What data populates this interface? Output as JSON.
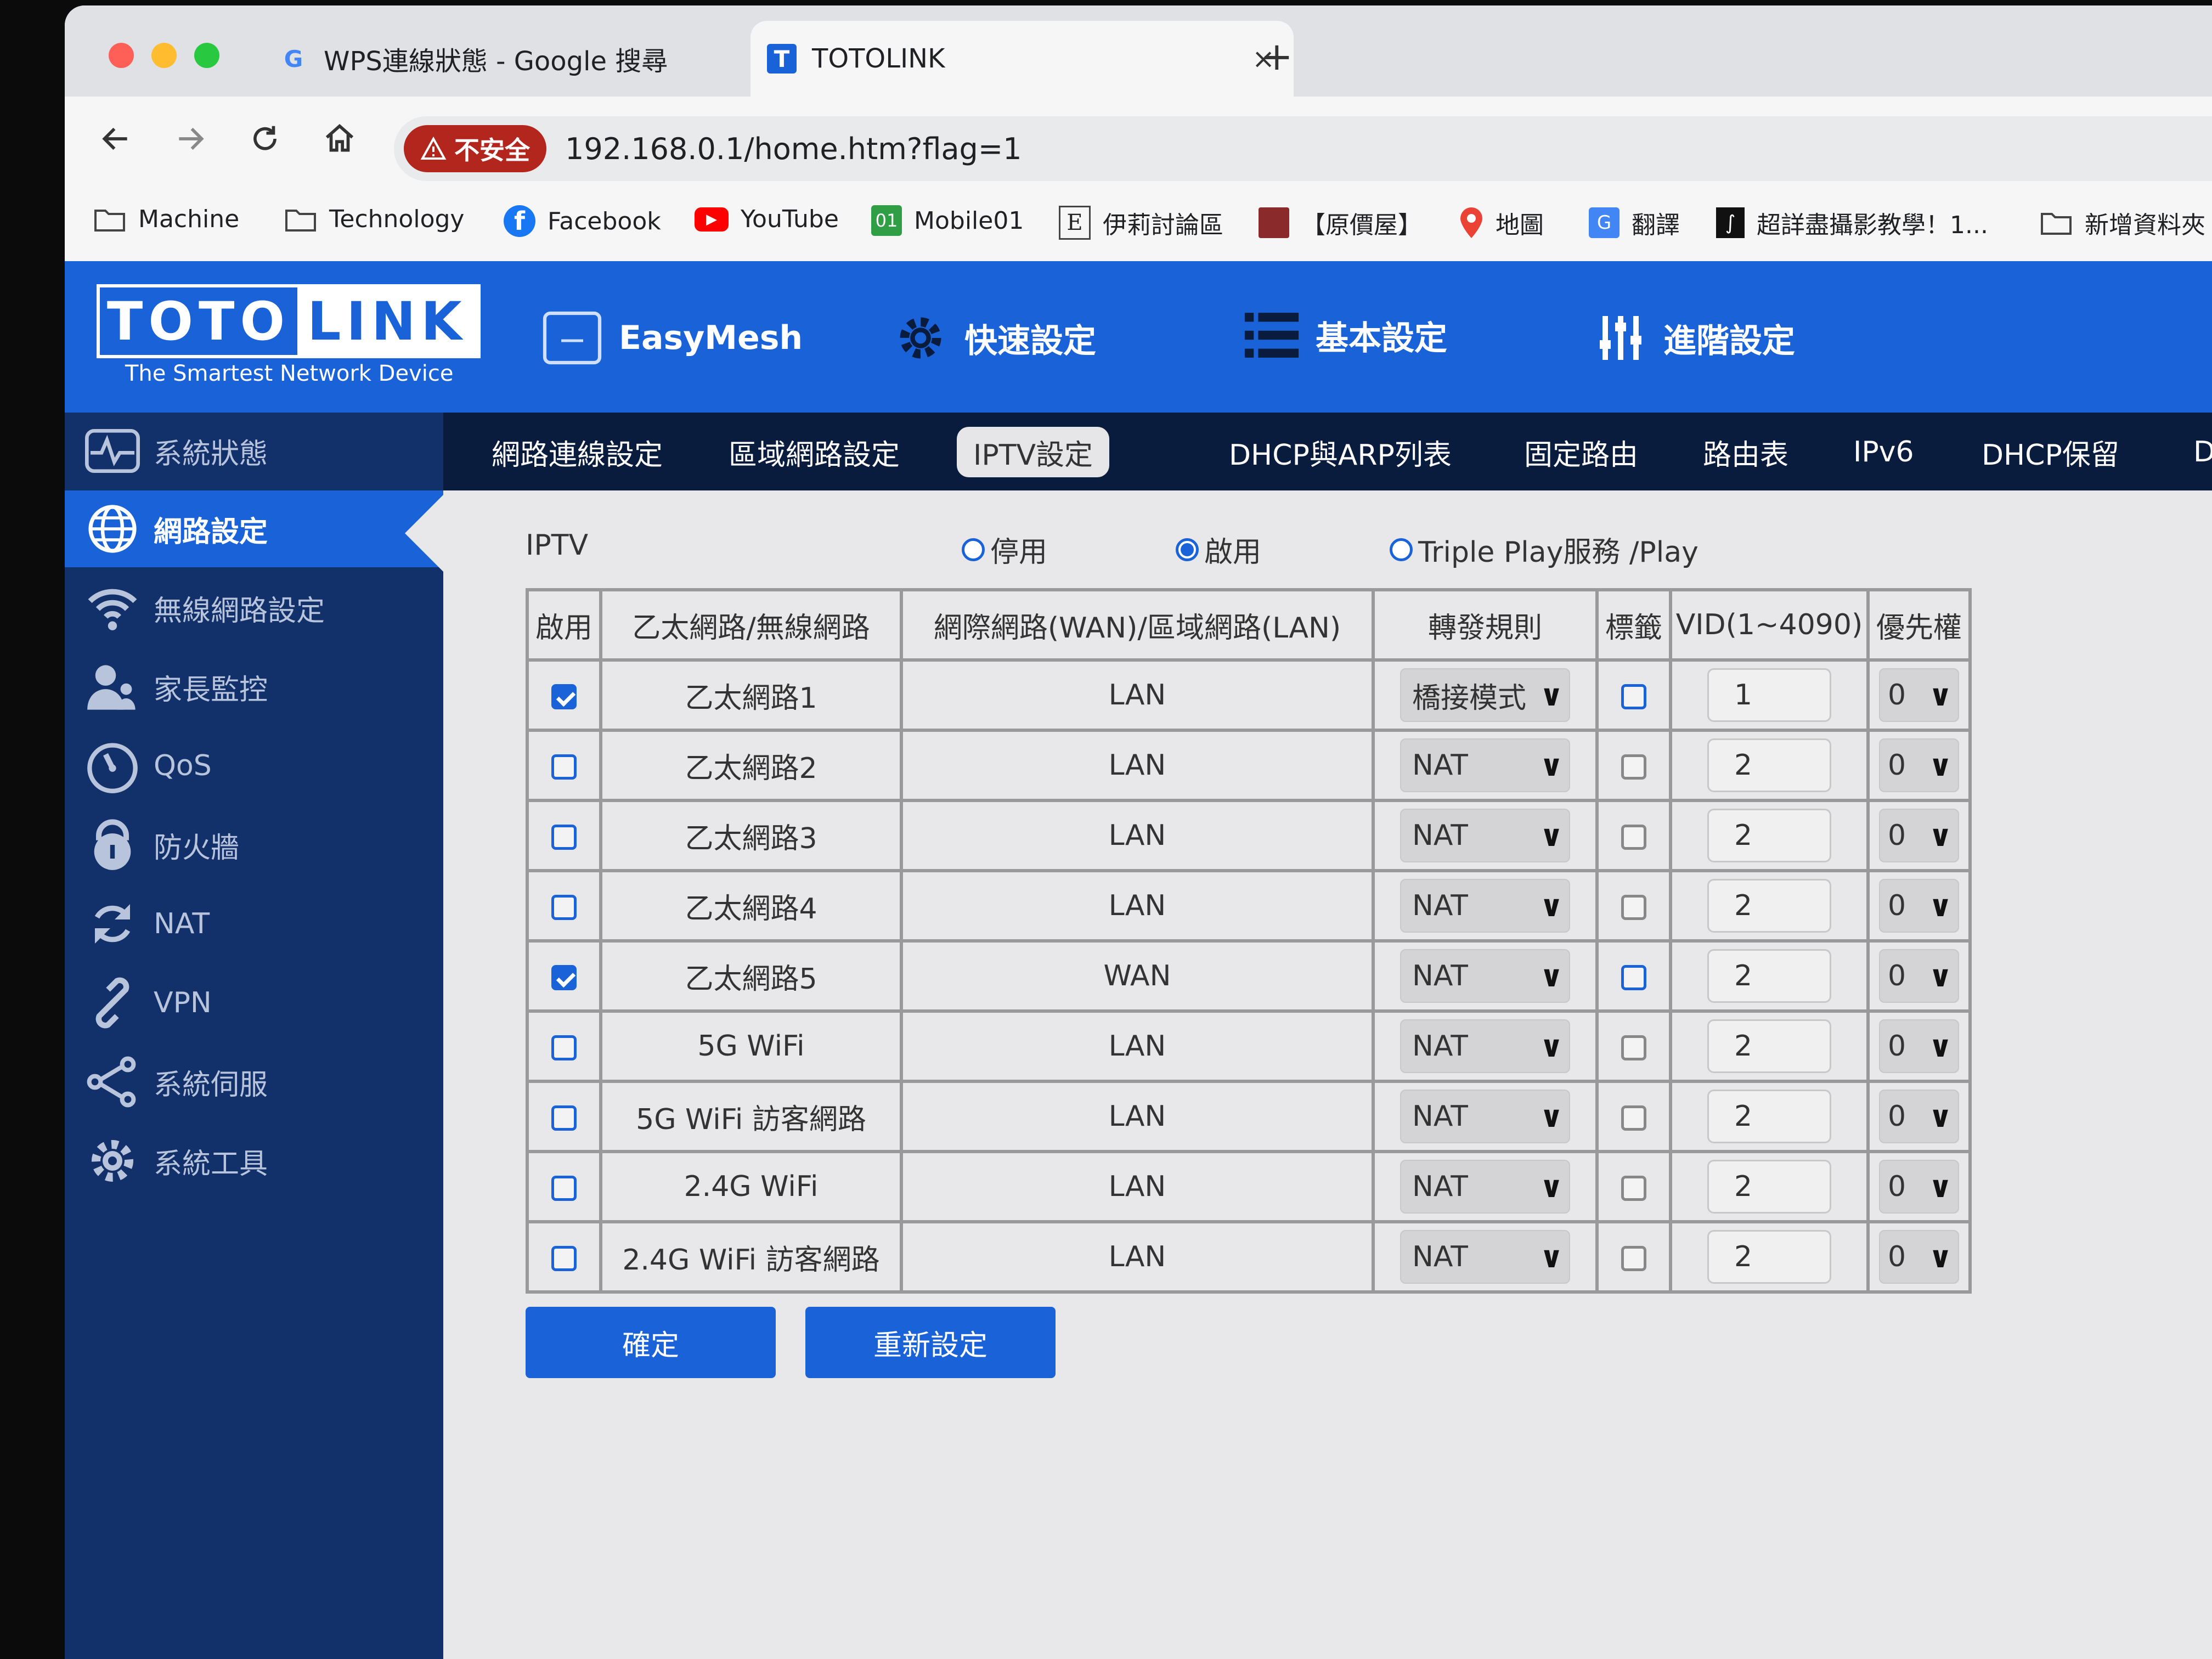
{
  "browser": {
    "tabs": [
      {
        "title": "WPS連線狀態 - Google 搜尋",
        "favicon": "G"
      },
      {
        "title": "TOTOLINK",
        "favicon": "T"
      }
    ],
    "new_tab_label": "+",
    "close_label": "×",
    "security_label": "不安全",
    "url": "192.168.0.1/home.htm?flag=1",
    "bookmarks": [
      {
        "label": "Machine",
        "icon": "folder-icon"
      },
      {
        "label": "Technology",
        "icon": "folder-icon"
      },
      {
        "label": "Facebook",
        "icon": "facebook-icon"
      },
      {
        "label": "YouTube",
        "icon": "youtube-icon"
      },
      {
        "label": "Mobile01",
        "icon": "mobile01-icon"
      },
      {
        "label": "伊莉討論區",
        "icon": "eyny-icon"
      },
      {
        "label": "【原價屋】",
        "icon": "coolpc-icon"
      },
      {
        "label": "地圖",
        "icon": "maps-icon"
      },
      {
        "label": "翻譯",
        "icon": "translate-icon"
      },
      {
        "label": "超詳盡攝影教學！1...",
        "icon": "bookmark-icon"
      },
      {
        "label": "新增資料夾",
        "icon": "folder-icon"
      }
    ]
  },
  "brand": {
    "logo_left": "TOTO",
    "logo_right": "LINK",
    "tagline": "The Smartest Network Device",
    "color": "#1a62d8"
  },
  "top_nav": [
    {
      "label": "EasyMesh",
      "icon": "easymesh-icon"
    },
    {
      "label": "快速設定",
      "icon": "gear-icon"
    },
    {
      "label": "基本設定",
      "icon": "list-icon"
    },
    {
      "label": "進階設定",
      "icon": "sliders-icon"
    }
  ],
  "sidebar": {
    "items": [
      {
        "label": "系統狀態",
        "icon": "pulse-icon"
      },
      {
        "label": "網路設定",
        "icon": "globe-icon",
        "active": true
      },
      {
        "label": "無線網路設定",
        "icon": "wifi-icon"
      },
      {
        "label": "家長監控",
        "icon": "parent-icon"
      },
      {
        "label": "QoS",
        "icon": "gauge-icon"
      },
      {
        "label": "防火牆",
        "icon": "lock-icon"
      },
      {
        "label": "NAT",
        "icon": "refresh-icon"
      },
      {
        "label": "VPN",
        "icon": "link-icon"
      },
      {
        "label": "系統伺服",
        "icon": "share-icon"
      },
      {
        "label": "系統工具",
        "icon": "gear-icon"
      }
    ]
  },
  "subnav": {
    "tabs": [
      {
        "label": "網路連線設定"
      },
      {
        "label": "區域網路設定"
      },
      {
        "label": "IPTV設定",
        "active": true
      },
      {
        "label": "DHCP與ARP列表"
      },
      {
        "label": "固定路由"
      },
      {
        "label": "路由表"
      },
      {
        "label": "IPv6"
      },
      {
        "label": "DHCP保留"
      },
      {
        "label": "DDNS"
      }
    ]
  },
  "iptv": {
    "label": "IPTV",
    "mode_options": [
      {
        "label": "停用",
        "selected": false
      },
      {
        "label": "啟用",
        "selected": true
      },
      {
        "label": "Triple Play服務 /Play",
        "selected": false
      }
    ],
    "headers": [
      "啟用",
      "乙太網路/無線網路",
      "網際網路(WAN)/區域網路(LAN)",
      "轉發規則",
      "標籤",
      "VID(1~4090)",
      "優先權"
    ],
    "rows": [
      {
        "enabled": true,
        "port": "乙太網路1",
        "type": "LAN",
        "rule": "橋接模式",
        "tag": false,
        "vid": "1",
        "priority": "0"
      },
      {
        "enabled": false,
        "port": "乙太網路2",
        "type": "LAN",
        "rule": "NAT",
        "tag": false,
        "vid": "2",
        "priority": "0"
      },
      {
        "enabled": false,
        "port": "乙太網路3",
        "type": "LAN",
        "rule": "NAT",
        "tag": false,
        "vid": "2",
        "priority": "0"
      },
      {
        "enabled": false,
        "port": "乙太網路4",
        "type": "LAN",
        "rule": "NAT",
        "tag": false,
        "vid": "2",
        "priority": "0"
      },
      {
        "enabled": true,
        "port": "乙太網路5",
        "type": "WAN",
        "rule": "NAT",
        "tag": false,
        "vid": "2",
        "priority": "0"
      },
      {
        "enabled": false,
        "port": "5G WiFi",
        "type": "LAN",
        "rule": "NAT",
        "tag": false,
        "vid": "2",
        "priority": "0"
      },
      {
        "enabled": false,
        "port": "5G WiFi 訪客網路",
        "type": "LAN",
        "rule": "NAT",
        "tag": false,
        "vid": "2",
        "priority": "0"
      },
      {
        "enabled": false,
        "port": "2.4G WiFi",
        "type": "LAN",
        "rule": "NAT",
        "tag": false,
        "vid": "2",
        "priority": "0"
      },
      {
        "enabled": false,
        "port": "2.4G WiFi 訪客網路",
        "type": "LAN",
        "rule": "NAT",
        "tag": false,
        "vid": "2",
        "priority": "0"
      }
    ],
    "confirm_label": "確定",
    "reset_label": "重新設定"
  }
}
